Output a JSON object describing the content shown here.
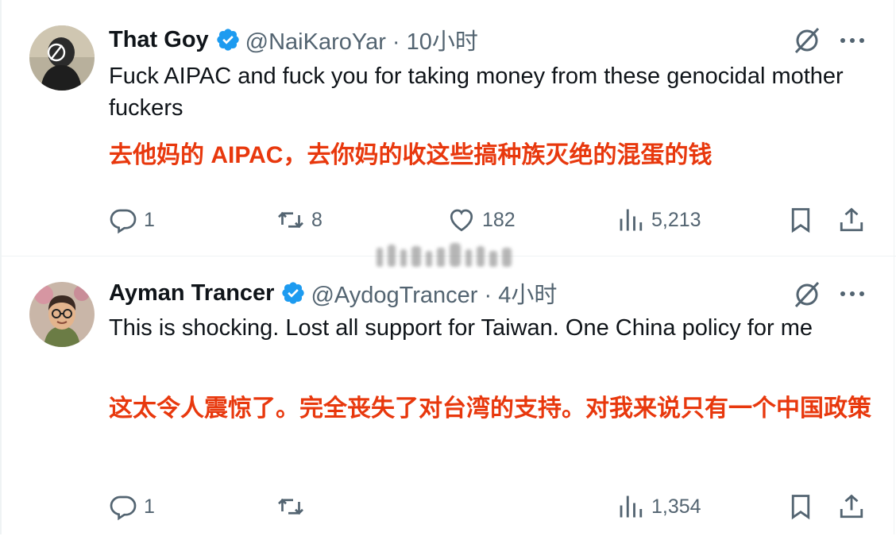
{
  "tweets": [
    {
      "name": "That Goy",
      "handle": "@NaiKaroYar · 10小时",
      "text_en": "Fuck AIPAC and fuck you for taking money from these genocidal mother fuckers",
      "text_zh": "去他妈的 AIPAC，去你妈的收这些搞种族灭绝的混蛋的钱",
      "replies": "1",
      "reposts": "8",
      "likes": "182",
      "views": "5,213"
    },
    {
      "name": "Ayman Trancer",
      "handle": "@AydogTrancer · 4小时",
      "text_en": "This is shocking. Lost all support for Taiwan. One China policy for me",
      "text_zh": "这太令人震惊了。完全丧失了对台湾的支持。对我来说只有一个中国政策",
      "replies": "1",
      "reposts": "",
      "likes": "",
      "views": "1,354"
    }
  ],
  "colors": {
    "accent": "#1d9bf0",
    "muted": "#536471",
    "translation": "#e8380d"
  },
  "icons": [
    "reply-icon",
    "repost-icon",
    "like-icon",
    "views-icon",
    "bookmark-icon",
    "share-icon",
    "grok-icon",
    "more-icon",
    "verified-icon"
  ]
}
